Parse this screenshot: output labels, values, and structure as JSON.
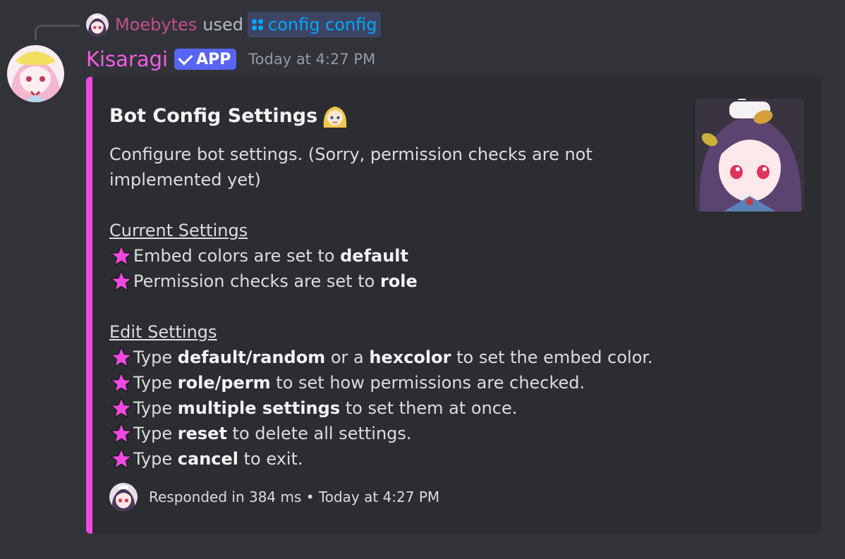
{
  "reply": {
    "user": "Moebytes",
    "used": "used",
    "command": "config config"
  },
  "message": {
    "author": "Kisaragi",
    "badge": "APP",
    "timestamp": "Today at 4:27 PM"
  },
  "embed": {
    "accent_color": "#f048e0",
    "title": "Bot Config Settings",
    "intro": "Configure bot settings. (Sorry, permission checks are not implemented yet)",
    "current_heading": "Current Settings",
    "current_settings": [
      {
        "before": "Embed colors are set to ",
        "bold": "default"
      },
      {
        "before": "Permission checks are set to ",
        "bold": "role"
      }
    ],
    "edit_heading": "Edit Settings",
    "edit_settings": [
      {
        "before": "Type ",
        "bold": "default/random",
        "middle": " or a ",
        "bold2": "hexcolor",
        "after": " to set the embed color."
      },
      {
        "before": "Type ",
        "bold": "role/perm",
        "after": " to set how permissions are checked."
      },
      {
        "before": "Type ",
        "bold": "multiple settings",
        "after": " to set them at once."
      },
      {
        "before": "Type ",
        "bold": "reset",
        "after": " to delete all settings."
      },
      {
        "before": "Type ",
        "bold": "cancel",
        "after": " to exit."
      }
    ],
    "footer": "Responded in 384 ms • Today at 4:27 PM"
  },
  "icons": {
    "star": "star-icon",
    "command": "slash-command-icon",
    "verified": "checkmark-icon"
  },
  "colors": {
    "background": "#323339",
    "embed_background": "#2b2d31",
    "bot_name": "#f05ee0",
    "reply_user": "#c44d8f",
    "badge": "#5865f2",
    "command": "#00a8fc",
    "star": "#f048e0"
  }
}
